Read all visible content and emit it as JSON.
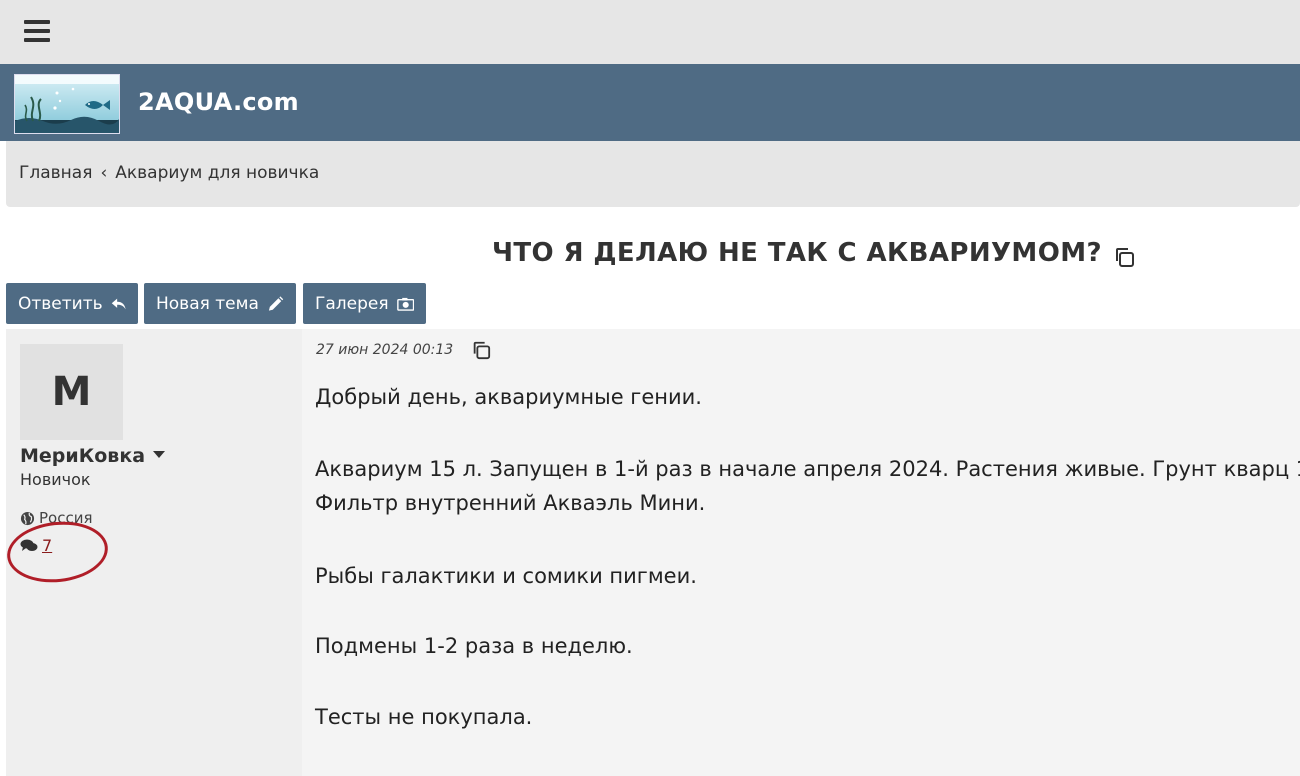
{
  "site": {
    "name": "2AQUA.com"
  },
  "breadcrumb": {
    "home": "Главная",
    "separator": "‹",
    "section": "Аквариум для новичка"
  },
  "topic": {
    "title": "ЧТО Я ДЕЛАЮ НЕ ТАК С АКВАРИУМОМ?"
  },
  "actions": {
    "reply": "Ответить",
    "new_topic": "Новая тема",
    "gallery": "Галерея"
  },
  "author": {
    "avatar_letter": "M",
    "name": "МериКовка",
    "rank": "Новичок",
    "location": "Россия",
    "post_count": "7"
  },
  "post": {
    "date": "27 июн 2024 00:13",
    "paragraphs": [
      "Добрый день, аквариумные гении.",
      "Аквариум 15 л. Запущен в 1-й раз в начале апреля 2024. Растения живые. Грунт кварц 1-",
      "Фильтр внутренний Акваэль Мини.",
      "Рыбы галактики и сомики пигмеи.",
      "Подмены 1-2 раза в неделю.",
      "Тесты не покупала."
    ]
  },
  "colors": {
    "brand": "#4f6b84",
    "highlight": "#b01e28",
    "link": "#8a1c1c"
  }
}
